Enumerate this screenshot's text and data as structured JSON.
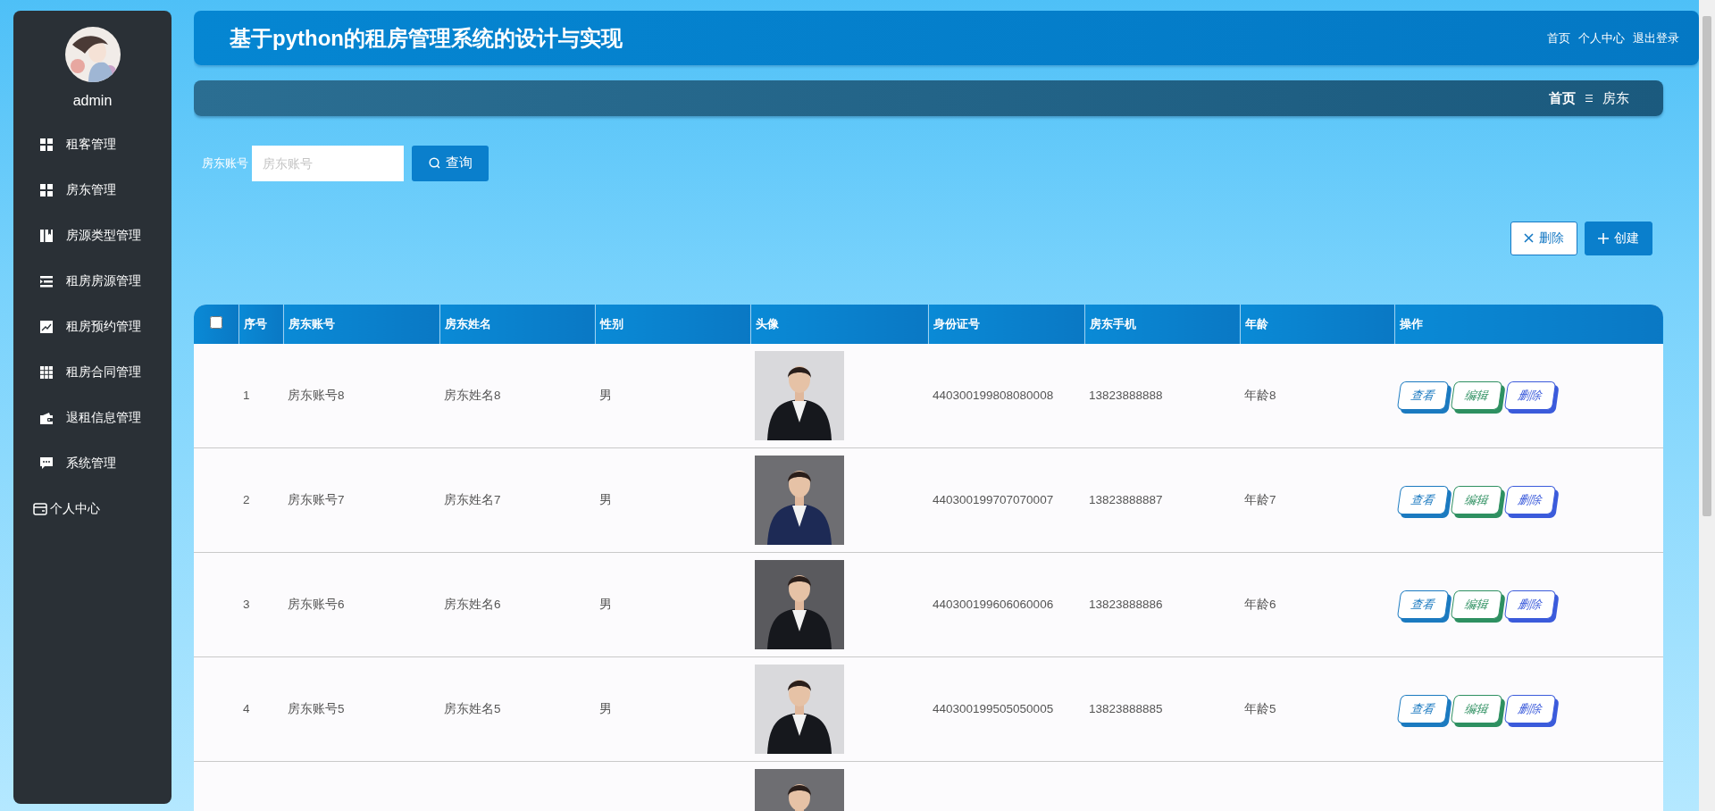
{
  "sidebar": {
    "user": "admin",
    "items": [
      {
        "label": "租客管理",
        "kind": "grid"
      },
      {
        "label": "房东管理",
        "kind": "grid"
      },
      {
        "label": "房源类型管理",
        "kind": "book"
      },
      {
        "label": "租房房源管理",
        "kind": "list"
      },
      {
        "label": "租房预约管理",
        "kind": "chart"
      },
      {
        "label": "租房合同管理",
        "kind": "table"
      },
      {
        "label": "退租信息管理",
        "kind": "wallet"
      },
      {
        "label": "系统管理",
        "kind": "chat"
      },
      {
        "label": "个人中心",
        "kind": "card"
      }
    ]
  },
  "header": {
    "title": "基于python的租房管理系统的设计与实现",
    "links": [
      "首页",
      "个人中心",
      "退出登录"
    ]
  },
  "breadcrumb": [
    "首页",
    "房东"
  ],
  "search": {
    "label": "房东账号",
    "placeholder": "房东账号",
    "button": "查询"
  },
  "toolbar": [
    {
      "label": "删除",
      "kind": "delete"
    },
    {
      "label": "创建",
      "kind": "create"
    }
  ],
  "table": {
    "select_all": {
      "checked": false
    },
    "columns": [
      "序号",
      "房东账号",
      "房东姓名",
      "性别",
      "头像",
      "身份证号",
      "房东手机",
      "年龄",
      "操作"
    ],
    "rows": [
      {
        "index": "1",
        "account": "房东账号8",
        "name": "房东姓名8",
        "gender": "男",
        "id_number": "440300199808080008",
        "phone": "13823888888",
        "age": "年龄8",
        "actions": [
          {
            "label": "查看",
            "kind": "view"
          },
          {
            "label": "编辑",
            "kind": "edit"
          },
          {
            "label": "删除",
            "kind": "delete"
          }
        ]
      },
      {
        "index": "2",
        "account": "房东账号7",
        "name": "房东姓名7",
        "gender": "男",
        "id_number": "440300199707070007",
        "phone": "13823888887",
        "age": "年龄7",
        "actions": [
          {
            "label": "查看",
            "kind": "view"
          },
          {
            "label": "编辑",
            "kind": "edit"
          },
          {
            "label": "删除",
            "kind": "delete"
          }
        ]
      },
      {
        "index": "3",
        "account": "房东账号6",
        "name": "房东姓名6",
        "gender": "男",
        "id_number": "440300199606060006",
        "phone": "13823888886",
        "age": "年龄6",
        "actions": [
          {
            "label": "查看",
            "kind": "view"
          },
          {
            "label": "编辑",
            "kind": "edit"
          },
          {
            "label": "删除",
            "kind": "delete"
          }
        ]
      },
      {
        "index": "4",
        "account": "房东账号5",
        "name": "房东姓名5",
        "gender": "男",
        "id_number": "440300199505050005",
        "phone": "13823888885",
        "age": "年龄5",
        "actions": [
          {
            "label": "查看",
            "kind": "view"
          },
          {
            "label": "编辑",
            "kind": "edit"
          },
          {
            "label": "删除",
            "kind": "delete"
          }
        ]
      },
      {
        "kind": "picture"
      }
    ]
  }
}
